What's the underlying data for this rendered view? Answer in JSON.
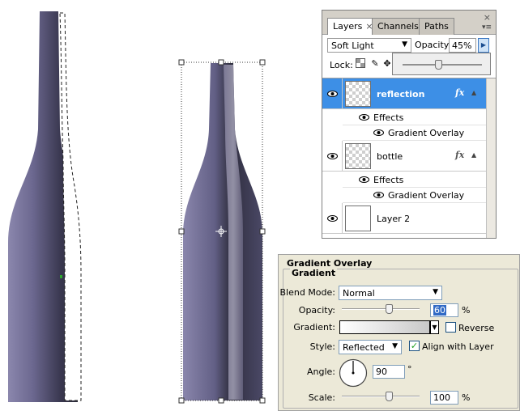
{
  "layers_panel": {
    "tabs": [
      {
        "label": "Layers",
        "close": "×"
      },
      {
        "label": "Channels"
      },
      {
        "label": "Paths"
      }
    ],
    "panel_close": "×",
    "blend_mode": "Soft Light",
    "opacity_label": "Opacity:",
    "opacity_value": "45%",
    "opacity_slider": 0.45,
    "lock_label": "Lock:",
    "layers": [
      {
        "name": "reflection",
        "fx": "fx",
        "selected": true,
        "effects_label": "Effects",
        "effect": "Gradient Overlay"
      },
      {
        "name": "bottle",
        "fx": "fx",
        "selected": false,
        "effects_label": "Effects",
        "effect": "Gradient Overlay"
      },
      {
        "name": "Layer 2",
        "selected": false
      }
    ]
  },
  "gradient_overlay": {
    "title": "Gradient Overlay",
    "group_title": "Gradient",
    "blend_mode_label": "Blend Mode:",
    "blend_mode_value": "Normal",
    "opacity_label": "Opacity:",
    "opacity_value": "60",
    "opacity_unit": "%",
    "opacity_slider": 0.6,
    "gradient_label": "Gradient:",
    "reverse_label": "Reverse",
    "reverse_checked": false,
    "style_label": "Style:",
    "style_value": "Reflected",
    "align_label": "Align with Layer",
    "align_checked": true,
    "angle_label": "Angle:",
    "angle_value": "90",
    "angle_unit": "°",
    "scale_label": "Scale:",
    "scale_value": "100",
    "scale_unit": "%",
    "scale_slider": 0.6
  },
  "colors": {
    "bottle_dark": "#2e2d3d",
    "bottle_light": "#8b87ad",
    "selection_blue": "#3d8fe6"
  }
}
